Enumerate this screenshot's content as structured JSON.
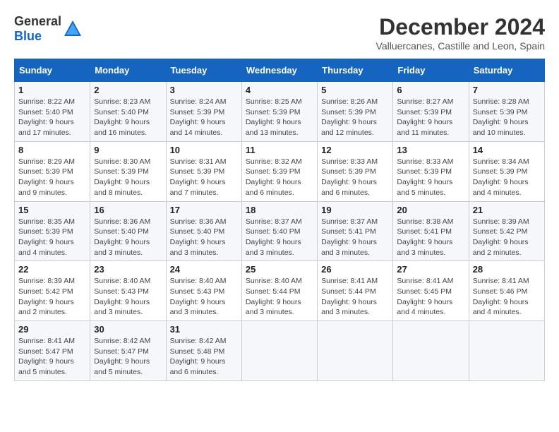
{
  "header": {
    "logo_general": "General",
    "logo_blue": "Blue",
    "month_title": "December 2024",
    "location": "Valluercanes, Castille and Leon, Spain"
  },
  "weekdays": [
    "Sunday",
    "Monday",
    "Tuesday",
    "Wednesday",
    "Thursday",
    "Friday",
    "Saturday"
  ],
  "weeks": [
    [
      {
        "day": "1",
        "sunrise": "Sunrise: 8:22 AM",
        "sunset": "Sunset: 5:40 PM",
        "daylight": "Daylight: 9 hours and 17 minutes."
      },
      {
        "day": "2",
        "sunrise": "Sunrise: 8:23 AM",
        "sunset": "Sunset: 5:40 PM",
        "daylight": "Daylight: 9 hours and 16 minutes."
      },
      {
        "day": "3",
        "sunrise": "Sunrise: 8:24 AM",
        "sunset": "Sunset: 5:39 PM",
        "daylight": "Daylight: 9 hours and 14 minutes."
      },
      {
        "day": "4",
        "sunrise": "Sunrise: 8:25 AM",
        "sunset": "Sunset: 5:39 PM",
        "daylight": "Daylight: 9 hours and 13 minutes."
      },
      {
        "day": "5",
        "sunrise": "Sunrise: 8:26 AM",
        "sunset": "Sunset: 5:39 PM",
        "daylight": "Daylight: 9 hours and 12 minutes."
      },
      {
        "day": "6",
        "sunrise": "Sunrise: 8:27 AM",
        "sunset": "Sunset: 5:39 PM",
        "daylight": "Daylight: 9 hours and 11 minutes."
      },
      {
        "day": "7",
        "sunrise": "Sunrise: 8:28 AM",
        "sunset": "Sunset: 5:39 PM",
        "daylight": "Daylight: 9 hours and 10 minutes."
      }
    ],
    [
      {
        "day": "8",
        "sunrise": "Sunrise: 8:29 AM",
        "sunset": "Sunset: 5:39 PM",
        "daylight": "Daylight: 9 hours and 9 minutes."
      },
      {
        "day": "9",
        "sunrise": "Sunrise: 8:30 AM",
        "sunset": "Sunset: 5:39 PM",
        "daylight": "Daylight: 9 hours and 8 minutes."
      },
      {
        "day": "10",
        "sunrise": "Sunrise: 8:31 AM",
        "sunset": "Sunset: 5:39 PM",
        "daylight": "Daylight: 9 hours and 7 minutes."
      },
      {
        "day": "11",
        "sunrise": "Sunrise: 8:32 AM",
        "sunset": "Sunset: 5:39 PM",
        "daylight": "Daylight: 9 hours and 6 minutes."
      },
      {
        "day": "12",
        "sunrise": "Sunrise: 8:33 AM",
        "sunset": "Sunset: 5:39 PM",
        "daylight": "Daylight: 9 hours and 6 minutes."
      },
      {
        "day": "13",
        "sunrise": "Sunrise: 8:33 AM",
        "sunset": "Sunset: 5:39 PM",
        "daylight": "Daylight: 9 hours and 5 minutes."
      },
      {
        "day": "14",
        "sunrise": "Sunrise: 8:34 AM",
        "sunset": "Sunset: 5:39 PM",
        "daylight": "Daylight: 9 hours and 4 minutes."
      }
    ],
    [
      {
        "day": "15",
        "sunrise": "Sunrise: 8:35 AM",
        "sunset": "Sunset: 5:39 PM",
        "daylight": "Daylight: 9 hours and 4 minutes."
      },
      {
        "day": "16",
        "sunrise": "Sunrise: 8:36 AM",
        "sunset": "Sunset: 5:40 PM",
        "daylight": "Daylight: 9 hours and 3 minutes."
      },
      {
        "day": "17",
        "sunrise": "Sunrise: 8:36 AM",
        "sunset": "Sunset: 5:40 PM",
        "daylight": "Daylight: 9 hours and 3 minutes."
      },
      {
        "day": "18",
        "sunrise": "Sunrise: 8:37 AM",
        "sunset": "Sunset: 5:40 PM",
        "daylight": "Daylight: 9 hours and 3 minutes."
      },
      {
        "day": "19",
        "sunrise": "Sunrise: 8:37 AM",
        "sunset": "Sunset: 5:41 PM",
        "daylight": "Daylight: 9 hours and 3 minutes."
      },
      {
        "day": "20",
        "sunrise": "Sunrise: 8:38 AM",
        "sunset": "Sunset: 5:41 PM",
        "daylight": "Daylight: 9 hours and 3 minutes."
      },
      {
        "day": "21",
        "sunrise": "Sunrise: 8:39 AM",
        "sunset": "Sunset: 5:42 PM",
        "daylight": "Daylight: 9 hours and 2 minutes."
      }
    ],
    [
      {
        "day": "22",
        "sunrise": "Sunrise: 8:39 AM",
        "sunset": "Sunset: 5:42 PM",
        "daylight": "Daylight: 9 hours and 2 minutes."
      },
      {
        "day": "23",
        "sunrise": "Sunrise: 8:40 AM",
        "sunset": "Sunset: 5:43 PM",
        "daylight": "Daylight: 9 hours and 3 minutes."
      },
      {
        "day": "24",
        "sunrise": "Sunrise: 8:40 AM",
        "sunset": "Sunset: 5:43 PM",
        "daylight": "Daylight: 9 hours and 3 minutes."
      },
      {
        "day": "25",
        "sunrise": "Sunrise: 8:40 AM",
        "sunset": "Sunset: 5:44 PM",
        "daylight": "Daylight: 9 hours and 3 minutes."
      },
      {
        "day": "26",
        "sunrise": "Sunrise: 8:41 AM",
        "sunset": "Sunset: 5:44 PM",
        "daylight": "Daylight: 9 hours and 3 minutes."
      },
      {
        "day": "27",
        "sunrise": "Sunrise: 8:41 AM",
        "sunset": "Sunset: 5:45 PM",
        "daylight": "Daylight: 9 hours and 4 minutes."
      },
      {
        "day": "28",
        "sunrise": "Sunrise: 8:41 AM",
        "sunset": "Sunset: 5:46 PM",
        "daylight": "Daylight: 9 hours and 4 minutes."
      }
    ],
    [
      {
        "day": "29",
        "sunrise": "Sunrise: 8:41 AM",
        "sunset": "Sunset: 5:47 PM",
        "daylight": "Daylight: 9 hours and 5 minutes."
      },
      {
        "day": "30",
        "sunrise": "Sunrise: 8:42 AM",
        "sunset": "Sunset: 5:47 PM",
        "daylight": "Daylight: 9 hours and 5 minutes."
      },
      {
        "day": "31",
        "sunrise": "Sunrise: 8:42 AM",
        "sunset": "Sunset: 5:48 PM",
        "daylight": "Daylight: 9 hours and 6 minutes."
      },
      null,
      null,
      null,
      null
    ]
  ]
}
